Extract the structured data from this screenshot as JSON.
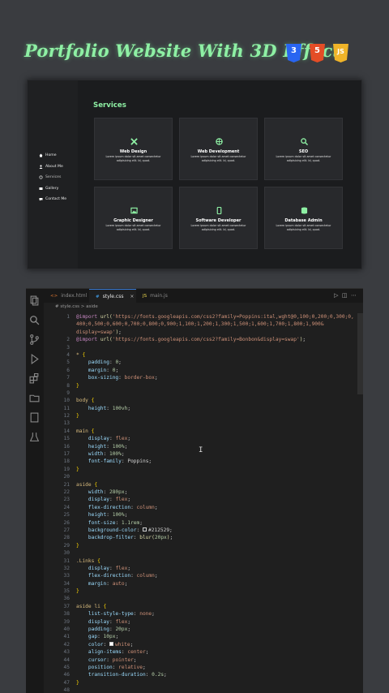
{
  "title": {
    "text": "Portfolio Website With 3D Effect",
    "badges": [
      "3",
      "5",
      "JS"
    ]
  },
  "preview": {
    "nav": [
      {
        "label": "Home",
        "icon": "home-icon"
      },
      {
        "label": "About Me",
        "icon": "user-icon"
      },
      {
        "label": "Services",
        "icon": "gear-icon"
      },
      {
        "label": "Gallery",
        "icon": "image-icon"
      },
      {
        "label": "Contact Me",
        "icon": "chat-icon"
      }
    ],
    "heading": "Services",
    "cards": [
      {
        "title": "Web Design",
        "desc": "Lorem ipsum dolor sit amet consectetur adipisicing elit. Id, quod.",
        "icon": "tools-icon"
      },
      {
        "title": "Web Development",
        "desc": "Lorem ipsum dolor sit amet consectetur adipisicing elit. Id, quod.",
        "icon": "globe-icon"
      },
      {
        "title": "SEO",
        "desc": "Lorem ipsum dolor sit amet consectetur adipisicing elit. Id, quod.",
        "icon": "search-icon"
      },
      {
        "title": "Graphic Designer",
        "desc": "Lorem ipsum dolor sit amet consectetur adipisicing elit. Id, quod.",
        "icon": "image-icon"
      },
      {
        "title": "Software Developer",
        "desc": "Lorem ipsum dolor sit amet consectetur adipisicing elit. Id, quod.",
        "icon": "phone-icon"
      },
      {
        "title": "Database Admin",
        "desc": "Lorem ipsum dolor sit amet consectetur adipisicing elit. Id, quod.",
        "icon": "database-icon"
      }
    ]
  },
  "editor": {
    "tabs": [
      {
        "label": "index.html",
        "icon": "<>",
        "active": false
      },
      {
        "label": "style.css",
        "icon": "#",
        "active": true
      },
      {
        "label": "main.js",
        "icon": "JS",
        "active": false
      }
    ],
    "breadcrumb": "# style.css  >  aside",
    "code": [
      {
        "n": "1",
        "t": [
          [
            "kw",
            "@import "
          ],
          [
            "fn",
            "url("
          ],
          [
            "str",
            "'https://fonts.googleapis.com/css2?family=Poppins:ital,wght@0,100;0,200;0,300;0,"
          ]
        ]
      },
      {
        "n": "",
        "t": [
          [
            "str",
            "400;0,500;0,600;0,700;0,800;0,900;1,100;1,200;1,300;1,500;1,600;1,700;1,800;1,900&"
          ]
        ]
      },
      {
        "n": "",
        "t": [
          [
            "str",
            "display=swap'"
          ],
          [
            "fn",
            ")"
          ],
          [
            "pun",
            ";"
          ]
        ]
      },
      {
        "n": "2",
        "t": [
          [
            "kw",
            "@import "
          ],
          [
            "fn",
            "url("
          ],
          [
            "str",
            "'https://fonts.googleapis.com/css2?family=Bonbon&display=swap'"
          ],
          [
            "fn",
            ")"
          ],
          [
            "pun",
            ";"
          ]
        ]
      },
      {
        "n": "3",
        "t": []
      },
      {
        "n": "4",
        "t": [
          [
            "sel",
            "* "
          ],
          [
            "brace",
            "{"
          ]
        ]
      },
      {
        "n": "5",
        "t": [
          [
            "prop",
            "    padding"
          ],
          [
            "pun",
            ": "
          ],
          [
            "num",
            "0"
          ],
          [
            "pun",
            ";"
          ]
        ]
      },
      {
        "n": "6",
        "t": [
          [
            "prop",
            "    margin"
          ],
          [
            "pun",
            ": "
          ],
          [
            "num",
            "0"
          ],
          [
            "pun",
            ";"
          ]
        ]
      },
      {
        "n": "7",
        "t": [
          [
            "prop",
            "    box-sizing"
          ],
          [
            "pun",
            ": "
          ],
          [
            "val",
            "border-box"
          ],
          [
            "pun",
            ";"
          ]
        ]
      },
      {
        "n": "8",
        "t": [
          [
            "brace",
            "}"
          ]
        ]
      },
      {
        "n": "9",
        "t": []
      },
      {
        "n": "10",
        "t": [
          [
            "sel",
            "body "
          ],
          [
            "brace",
            "{"
          ]
        ]
      },
      {
        "n": "11",
        "t": [
          [
            "prop",
            "    height"
          ],
          [
            "pun",
            ": "
          ],
          [
            "num",
            "100vh"
          ],
          [
            "pun",
            ";"
          ]
        ]
      },
      {
        "n": "12",
        "t": [
          [
            "brace",
            "}"
          ]
        ]
      },
      {
        "n": "13",
        "t": []
      },
      {
        "n": "14",
        "t": [
          [
            "sel",
            "main "
          ],
          [
            "brace",
            "{"
          ]
        ]
      },
      {
        "n": "15",
        "t": [
          [
            "prop",
            "    display"
          ],
          [
            "pun",
            ": "
          ],
          [
            "val",
            "flex"
          ],
          [
            "pun",
            ";"
          ]
        ]
      },
      {
        "n": "16",
        "t": [
          [
            "prop",
            "    height"
          ],
          [
            "pun",
            ": "
          ],
          [
            "num",
            "100%"
          ],
          [
            "pun",
            ";"
          ]
        ]
      },
      {
        "n": "17",
        "t": [
          [
            "prop",
            "    width"
          ],
          [
            "pun",
            ": "
          ],
          [
            "num",
            "100%"
          ],
          [
            "pun",
            ";"
          ]
        ]
      },
      {
        "n": "18",
        "t": [
          [
            "prop",
            "    font-family"
          ],
          [
            "pun",
            ": "
          ],
          [
            "plain",
            "Poppins"
          ],
          [
            "pun",
            ";"
          ]
        ]
      },
      {
        "n": "19",
        "t": [
          [
            "brace",
            "}"
          ]
        ]
      },
      {
        "n": "20",
        "t": []
      },
      {
        "n": "21",
        "t": [
          [
            "sel",
            "aside "
          ],
          [
            "brace",
            "{"
          ]
        ]
      },
      {
        "n": "22",
        "t": [
          [
            "prop",
            "    width"
          ],
          [
            "pun",
            ": "
          ],
          [
            "num",
            "280px"
          ],
          [
            "pun",
            ";"
          ]
        ]
      },
      {
        "n": "23",
        "t": [
          [
            "prop",
            "    display"
          ],
          [
            "pun",
            ": "
          ],
          [
            "val",
            "flex"
          ],
          [
            "pun",
            ";"
          ]
        ]
      },
      {
        "n": "24",
        "t": [
          [
            "prop",
            "    flex-direction"
          ],
          [
            "pun",
            ": "
          ],
          [
            "val",
            "column"
          ],
          [
            "pun",
            ";"
          ]
        ]
      },
      {
        "n": "25",
        "t": [
          [
            "prop",
            "    height"
          ],
          [
            "pun",
            ": "
          ],
          [
            "num",
            "100%"
          ],
          [
            "pun",
            ";"
          ]
        ]
      },
      {
        "n": "26",
        "t": [
          [
            "prop",
            "    font-size"
          ],
          [
            "pun",
            ": "
          ],
          [
            "num",
            "1.1rem"
          ],
          [
            "pun",
            ";"
          ]
        ]
      },
      {
        "n": "27",
        "t": [
          [
            "prop",
            "    background-color"
          ],
          [
            "pun",
            ": "
          ],
          [
            "box",
            "#212529"
          ],
          [
            "plain",
            "#212529"
          ],
          [
            "pun",
            ";"
          ]
        ]
      },
      {
        "n": "28",
        "t": [
          [
            "prop",
            "    backdrop-filter"
          ],
          [
            "pun",
            ": "
          ],
          [
            "fn",
            "blur("
          ],
          [
            "num",
            "20px"
          ],
          [
            "fn",
            ")"
          ],
          [
            "pun",
            ";"
          ]
        ]
      },
      {
        "n": "29",
        "t": [
          [
            "brace",
            "}"
          ]
        ]
      },
      {
        "n": "30",
        "t": []
      },
      {
        "n": "31",
        "t": [
          [
            "sel",
            ".Links "
          ],
          [
            "brace",
            "{"
          ]
        ]
      },
      {
        "n": "32",
        "t": [
          [
            "prop",
            "    display"
          ],
          [
            "pun",
            ": "
          ],
          [
            "val",
            "flex"
          ],
          [
            "pun",
            ";"
          ]
        ]
      },
      {
        "n": "33",
        "t": [
          [
            "prop",
            "    flex-direction"
          ],
          [
            "pun",
            ": "
          ],
          [
            "val",
            "column"
          ],
          [
            "pun",
            ";"
          ]
        ]
      },
      {
        "n": "34",
        "t": [
          [
            "prop",
            "    margin"
          ],
          [
            "pun",
            ": "
          ],
          [
            "val",
            "auto"
          ],
          [
            "pun",
            ";"
          ]
        ]
      },
      {
        "n": "35",
        "t": [
          [
            "brace",
            "}"
          ]
        ]
      },
      {
        "n": "36",
        "t": []
      },
      {
        "n": "37",
        "t": [
          [
            "sel",
            "aside li "
          ],
          [
            "brace",
            "{"
          ]
        ]
      },
      {
        "n": "38",
        "t": [
          [
            "prop",
            "    list-style-type"
          ],
          [
            "pun",
            ": "
          ],
          [
            "val",
            "none"
          ],
          [
            "pun",
            ";"
          ]
        ]
      },
      {
        "n": "39",
        "t": [
          [
            "prop",
            "    display"
          ],
          [
            "pun",
            ": "
          ],
          [
            "val",
            "flex"
          ],
          [
            "pun",
            ";"
          ]
        ]
      },
      {
        "n": "40",
        "t": [
          [
            "prop",
            "    padding"
          ],
          [
            "pun",
            ": "
          ],
          [
            "num",
            "20px"
          ],
          [
            "pun",
            ";"
          ]
        ]
      },
      {
        "n": "41",
        "t": [
          [
            "prop",
            "    gap"
          ],
          [
            "pun",
            ": "
          ],
          [
            "num",
            "10px"
          ],
          [
            "pun",
            ";"
          ]
        ]
      },
      {
        "n": "42",
        "t": [
          [
            "prop",
            "    color"
          ],
          [
            "pun",
            ": "
          ],
          [
            "box",
            "#ffffff"
          ],
          [
            "val",
            "white"
          ],
          [
            "pun",
            ";"
          ]
        ]
      },
      {
        "n": "43",
        "t": [
          [
            "prop",
            "    align-items"
          ],
          [
            "pun",
            ": "
          ],
          [
            "val",
            "center"
          ],
          [
            "pun",
            ";"
          ]
        ]
      },
      {
        "n": "44",
        "t": [
          [
            "prop",
            "    cursor"
          ],
          [
            "pun",
            ": "
          ],
          [
            "val",
            "pointer"
          ],
          [
            "pun",
            ";"
          ]
        ]
      },
      {
        "n": "45",
        "t": [
          [
            "prop",
            "    position"
          ],
          [
            "pun",
            ": "
          ],
          [
            "val",
            "relative"
          ],
          [
            "pun",
            ";"
          ]
        ]
      },
      {
        "n": "46",
        "t": [
          [
            "prop",
            "    transition-duration"
          ],
          [
            "pun",
            ": "
          ],
          [
            "num",
            "0.2s"
          ],
          [
            "pun",
            ";"
          ]
        ]
      },
      {
        "n": "47",
        "t": [
          [
            "brace",
            "}"
          ]
        ]
      },
      {
        "n": "48",
        "t": []
      }
    ]
  },
  "colors": {
    "accent": "#8ef0a4",
    "css": "#2965f1",
    "html": "#e44d26",
    "js": "#f0b429"
  }
}
